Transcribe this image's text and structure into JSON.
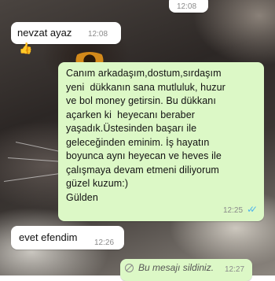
{
  "chat": {
    "messages": [
      {
        "direction": "incoming",
        "text": "",
        "time": "12:08"
      },
      {
        "direction": "incoming",
        "sender": "nevzat ayaz",
        "time": "12:08"
      },
      {
        "direction": "incoming",
        "icon": "thumbs-up-icon"
      },
      {
        "direction": "outgoing",
        "lines": [
          "Canım arkadaşım,dostum,sırdaşım",
          "yeni  dükkanın sana mutluluk, huzur",
          "ve bol money getirsin. Bu dükkanı",
          "açarken ki  heyecanı beraber",
          "yaşadık.Üstesinden başarı ile",
          "geleceğinden eminim. İş hayatın",
          "boyunca aynı heyecan ve heves ile",
          "çalışmaya devam etmeni diliyorum",
          "güzel kuzum:)",
          "Gülden"
        ],
        "time": "12:25",
        "status": "read",
        "status_icon": "double-check-icon"
      },
      {
        "direction": "incoming",
        "text": "evet efendim",
        "time": "12:26"
      },
      {
        "direction": "outgoing",
        "text": "Bu mesajı sildiniz.",
        "time": "12:27",
        "icon": "deleted-message-icon"
      }
    ]
  },
  "colors": {
    "incoming_bubble": "#ffffff",
    "outgoing_bubble": "#dcf8c6",
    "read_ticks": "#4fb6ec",
    "timestamp": "#8a8a8a"
  }
}
